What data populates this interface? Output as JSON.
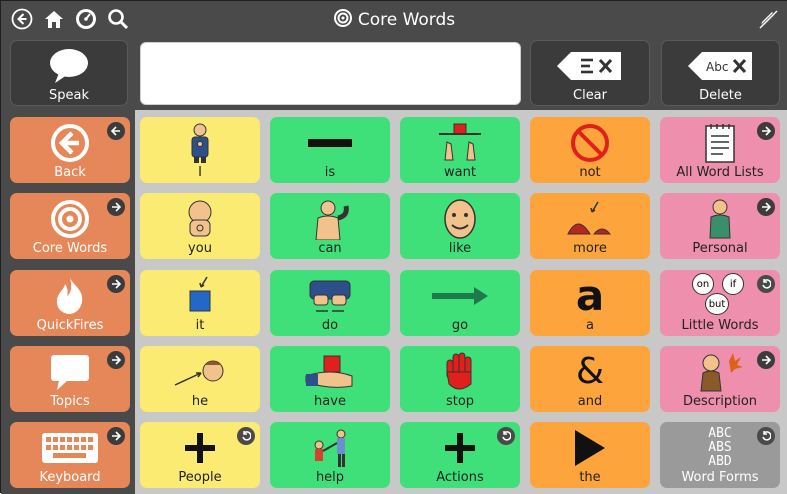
{
  "topbar": {
    "title": "Core Words",
    "icons": [
      "back-icon",
      "home-icon",
      "dashboard-icon",
      "search-icon",
      "edit-off-icon",
      "target-icon"
    ]
  },
  "message_row": {
    "speak_label": "Speak",
    "clear_label": "Clear",
    "delete_label": "Delete",
    "message_text": ""
  },
  "sidebar": {
    "items": [
      {
        "label": "Back"
      },
      {
        "label": "Core Words"
      },
      {
        "label": "QuickFires"
      },
      {
        "label": "Topics"
      },
      {
        "label": "Keyboard"
      }
    ]
  },
  "grid": {
    "col1": [
      {
        "label": "I"
      },
      {
        "label": "you"
      },
      {
        "label": "it"
      },
      {
        "label": "he"
      },
      {
        "label": "People"
      }
    ],
    "col2": [
      {
        "label": "is"
      },
      {
        "label": "can"
      },
      {
        "label": "do"
      },
      {
        "label": "have"
      },
      {
        "label": "help"
      }
    ],
    "col3": [
      {
        "label": "want"
      },
      {
        "label": "like"
      },
      {
        "label": "go"
      },
      {
        "label": "stop"
      },
      {
        "label": "Actions"
      }
    ],
    "col4": [
      {
        "label": "not"
      },
      {
        "label": "more"
      },
      {
        "label": "a"
      },
      {
        "label": "and"
      },
      {
        "label": "the"
      }
    ],
    "col5": [
      {
        "label": "All Word Lists"
      },
      {
        "label": "Personal"
      },
      {
        "label": "Little Words"
      },
      {
        "label": "Description"
      },
      {
        "label": "Word Forms"
      }
    ],
    "glyphs": {
      "little_words": [
        "on",
        "if",
        "but"
      ],
      "word_forms": [
        "ABC",
        "ABS",
        "ABD"
      ],
      "a_symbol": "a",
      "and_symbol": "&"
    }
  },
  "colors": {
    "pronoun_yellow": "#fbeb73",
    "verb_green": "#3fe079",
    "little_word_orange": "#fda43d",
    "folder_pink": "#ee8fae",
    "sidebar_orange": "#e58758",
    "word_forms_gray": "#9a9a9a"
  }
}
